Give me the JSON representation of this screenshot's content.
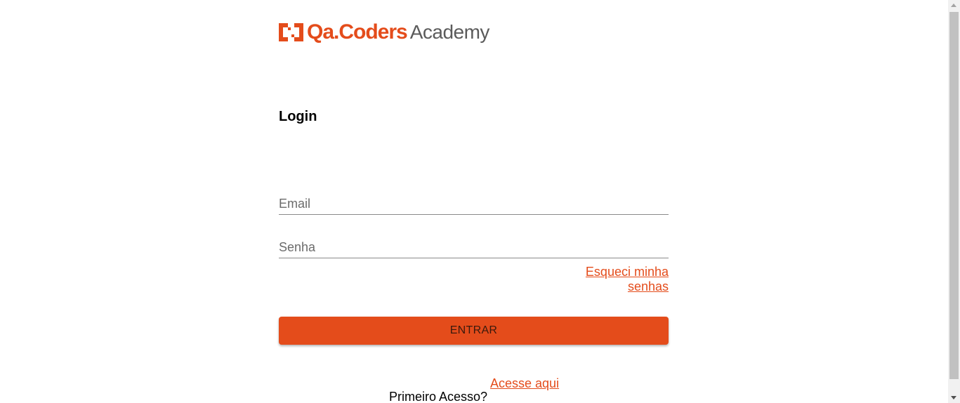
{
  "brand": {
    "name": "Qa.Coders",
    "subtitle": "Academy",
    "accent_color": "#e44c1b",
    "icon": "brackets-logo-icon"
  },
  "login": {
    "title": "Login",
    "email_placeholder": "Email",
    "email_value": "",
    "password_placeholder": "Senha",
    "password_value": "",
    "forgot_link": "Esqueci minha senhas",
    "submit_label": "ENTRAR"
  },
  "footer": {
    "first_access_label": "Primeiro Acesso?",
    "access_link": "Acesse aqui"
  }
}
